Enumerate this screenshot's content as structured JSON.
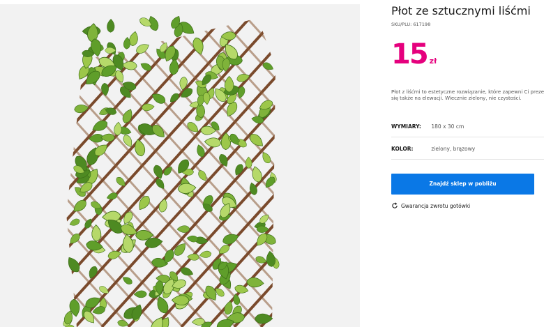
{
  "product": {
    "title": "Płot ze sztucznymi liśćmi",
    "sku": "SKU/PLU: 617198",
    "price": "15",
    "currency": "zł",
    "description": "Płot z liśćmi to estetyczne rozwiązanie, które zapewni Ci prezentuje się także na elewacji. Wiecznie zielony, nie czystości.",
    "specs": [
      {
        "label": "WYMIARY:",
        "value": "180 x 30 cm"
      },
      {
        "label": "KOLOR:",
        "value": "zielony, brązowy"
      }
    ],
    "cta_label": "Znajdź sklep w pobliżu",
    "guarantee": "Gwarancja zwrotu gotówki"
  },
  "image": {
    "icon": "leaf-fence-photo",
    "background_color": "#f2f2f2",
    "lattice_color": "#7a4a2c",
    "leaf_color": "#5f9e2a"
  },
  "colors": {
    "price": "#e5007d",
    "cta": "#0a78e6"
  }
}
